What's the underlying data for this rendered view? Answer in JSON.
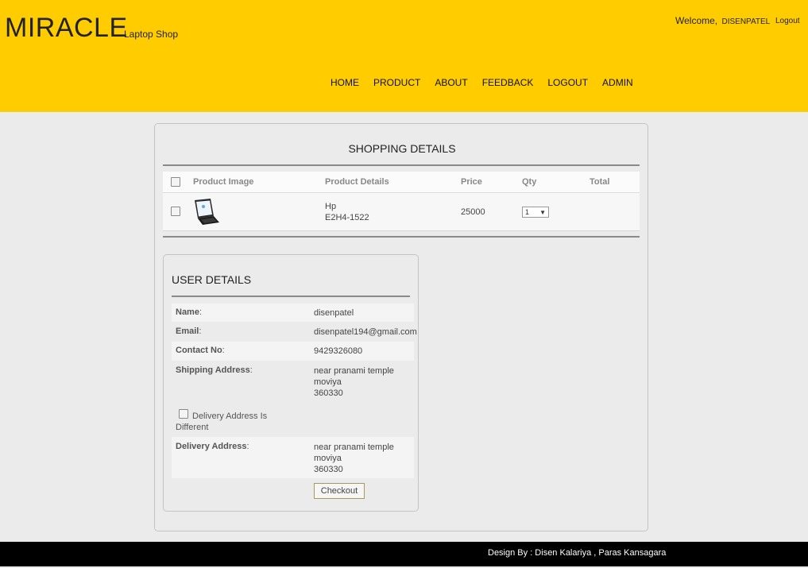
{
  "header": {
    "brand": "MIRACLE",
    "tagline": "Laptop Shop",
    "welcome_label": "Welcome,",
    "username": "DISENPATEL",
    "logout_link": "Logout",
    "nav": [
      "HOME",
      "PRODUCT",
      "ABOUT",
      "FEEDBACK",
      "LOGOUT",
      "ADMIN"
    ]
  },
  "shopping": {
    "title": "SHOPPING DETAILS",
    "columns": {
      "image": "Product Image",
      "details": "Product Details",
      "price": "Price",
      "qty": "Qty",
      "total": "Total"
    },
    "items": [
      {
        "image_icon": "laptop-icon",
        "brand": "Hp",
        "model": "E2H4-1522",
        "price": "25000",
        "qty": "1",
        "total": ""
      }
    ]
  },
  "user_details": {
    "title": "USER DETAILS",
    "name_label": "Name",
    "name": "disenpatel",
    "email_label": "Email",
    "email": "disenpatel194@gmail.com",
    "contact_label": "Contact No",
    "contact": "9429326080",
    "shipping_label": "Shipping Address",
    "shipping_address": [
      "near pranami temple",
      "moviya",
      "360330"
    ],
    "delivery_diff_label_1": "Delivery Address Is",
    "delivery_diff_label_2": "Different",
    "delivery_label": "Delivery Address",
    "delivery_address": [
      "near pranami temple",
      "moviya",
      "360330"
    ],
    "checkout_button": "Checkout"
  },
  "footer": {
    "credit": "Design By : Disen Kalariya , Paras Kansagara"
  },
  "colors": {
    "header_bg": "#ffcc00",
    "page_bg": "#ebebeb",
    "footer_bg": "#000000"
  }
}
